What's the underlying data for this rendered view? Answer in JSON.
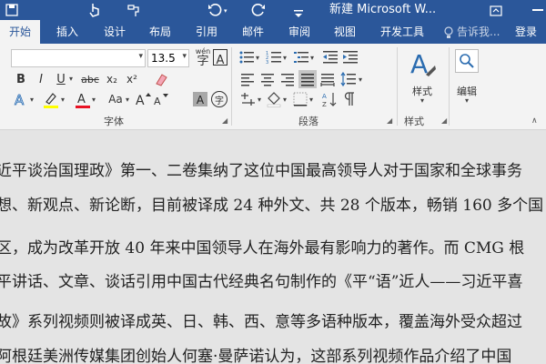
{
  "window": {
    "title": "新建 Microsoft W...",
    "title_bar_color": "#2b579a"
  },
  "quick_access": {
    "icons": [
      "save-icon",
      "touch-mode-icon",
      "format-painter-icon",
      "undo-icon",
      "redo-icon",
      "customize-icon"
    ]
  },
  "tabs": {
    "items": [
      {
        "label": "开始",
        "active": true
      },
      {
        "label": "插入"
      },
      {
        "label": "设计"
      },
      {
        "label": "布局"
      },
      {
        "label": "引用"
      },
      {
        "label": "邮件"
      },
      {
        "label": "审阅"
      },
      {
        "label": "视图"
      },
      {
        "label": "开发工具"
      }
    ],
    "tell_me_placeholder": "告诉我...",
    "login": "登录"
  },
  "ribbon": {
    "font_name": "",
    "font_size": "13.5",
    "groups": {
      "font": "字体",
      "paragraph": "段落",
      "styles": "样式",
      "editing": "编辑"
    },
    "styles_button": "样式",
    "editing_button": "编辑",
    "glyphs": {
      "bold": "B",
      "italic": "I",
      "underline": "U",
      "strike": "abc",
      "subscript": "x₂",
      "superscript": "x²",
      "font_color": "A",
      "change_case": "Aa",
      "grow_font": "A",
      "shrink_font": "A",
      "wen": "wén",
      "char_border": "A",
      "char_shading": "A",
      "enclose": "字"
    },
    "highlight_color": "#ffff00",
    "font_color": "#e81123"
  },
  "document": {
    "background": "#e4e4e4",
    "lines": [
      "近平谈治国理政》第一、二卷集纳了这位中国最高领导人对于国家和全球事务",
      "想、新观点、新论断，目前被译成 24 种外文、共 28 个版本，畅销 160 多个国",
      "区，成为改革开放 40 年来中国领导人在海外最有影响力的著作。而 CMG 根",
      "平讲话、文章、谈话引用中国古代经典名句制作的《平“语”近人——习近平喜",
      "故》系列视频则被译成英、日、韩、西、意等多语种版本，覆盖海外受众超过",
      "阿根廷美洲传媒集团创始人何塞·曼萨诺认为，这部系列视频作品介绍了中国"
    ]
  }
}
